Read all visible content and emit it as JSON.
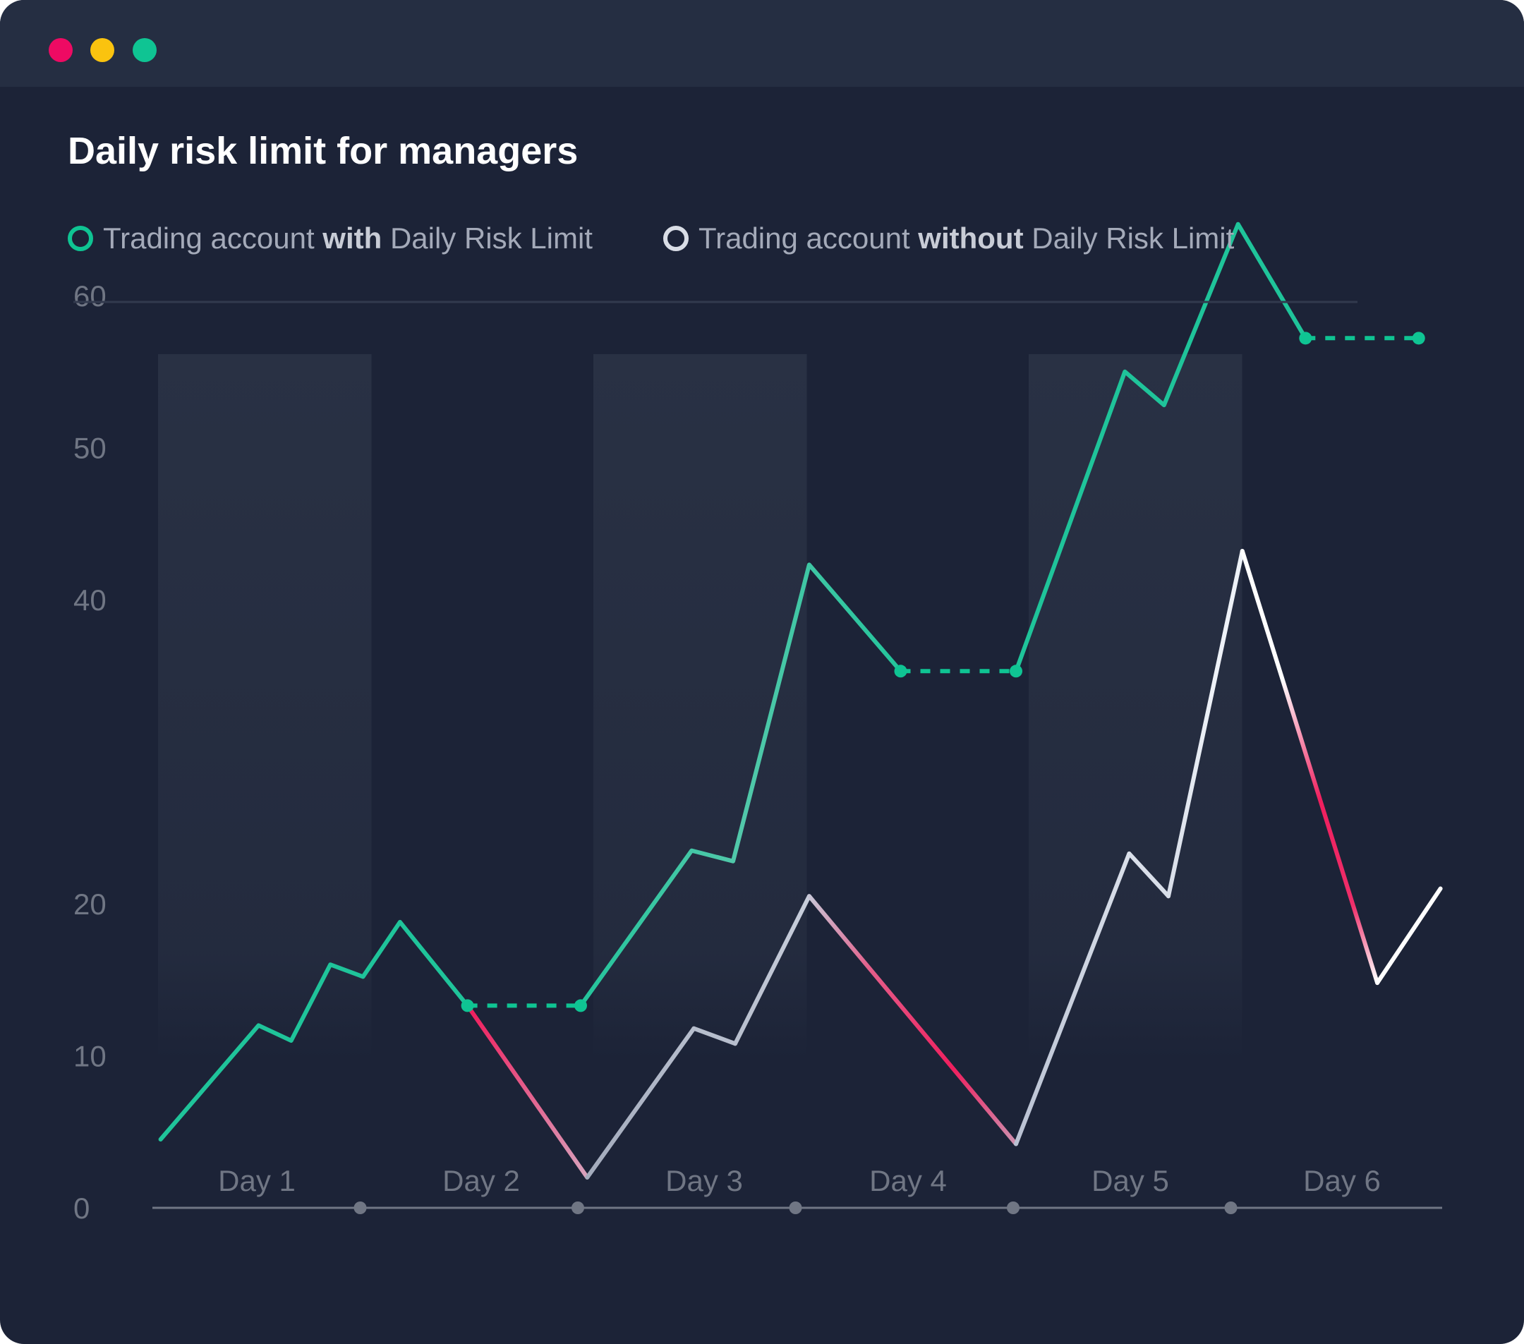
{
  "window": {
    "controls": [
      {
        "name": "close",
        "color": "#ee0a63"
      },
      {
        "name": "minimize",
        "color": "#fac30f"
      },
      {
        "name": "maximize",
        "color": "#0fc493"
      }
    ]
  },
  "colors": {
    "background": "#1c2337",
    "titlebar": "#252e42",
    "series_with": "#0fc493",
    "series_without": "#ffffff",
    "loss": "#ef1f5e",
    "axis": "#707684",
    "text_muted": "#707684",
    "band": "#293144"
  },
  "chart_data": {
    "type": "line",
    "title": "Daily risk limit for managers",
    "legend": {
      "placement": "top-left",
      "items": [
        {
          "prefix": "Trading account ",
          "emphasis": "with",
          "suffix": " Daily Risk Limit",
          "color": "#0fc493"
        },
        {
          "prefix": "Trading account ",
          "emphasis": "without",
          "suffix": " Daily Risk Limit",
          "color": "#d9dde6"
        }
      ]
    },
    "xlabel": "",
    "ylabel": "",
    "ylim": [
      0,
      65
    ],
    "yticks": [
      0,
      10,
      20,
      40,
      50,
      60
    ],
    "xlim": [
      0,
      6
    ],
    "categories": [
      "Day 1",
      "Day 2",
      "Day 3",
      "Day 4",
      "Day 5",
      "Day 6"
    ],
    "day_boundaries": [
      1,
      2,
      3,
      4,
      5
    ],
    "shaded_days": [
      1,
      3,
      5
    ],
    "grid": false,
    "series": [
      {
        "name": "Trading account with Daily Risk Limit",
        "color": "#0fc493",
        "points": [
          {
            "x": 0.07,
            "y": 4.5
          },
          {
            "x": 0.52,
            "y": 12.0
          },
          {
            "x": 0.67,
            "y": 11.0
          },
          {
            "x": 0.85,
            "y": 16.0
          },
          {
            "x": 1.0,
            "y": 15.2
          },
          {
            "x": 1.17,
            "y": 18.8
          },
          {
            "x": 1.48,
            "y": 13.3
          },
          {
            "x": 2.0,
            "y": 13.3,
            "limit": true
          },
          {
            "x": 2.51,
            "y": 23.5
          },
          {
            "x": 2.7,
            "y": 22.8
          },
          {
            "x": 3.05,
            "y": 42.3
          },
          {
            "x": 3.47,
            "y": 35.3
          },
          {
            "x": 4.0,
            "y": 35.3,
            "limit": true
          },
          {
            "x": 4.5,
            "y": 55.0
          },
          {
            "x": 4.68,
            "y": 52.8
          },
          {
            "x": 5.02,
            "y": 64.7
          },
          {
            "x": 5.33,
            "y": 57.2
          },
          {
            "x": 5.85,
            "y": 57.2,
            "limit": true
          }
        ]
      },
      {
        "name": "Trading account without Daily Risk Limit",
        "color": "#ffffff",
        "loss_color": "#ef1f5e",
        "points": [
          {
            "x": 1.48,
            "y": 13.3
          },
          {
            "x": 2.03,
            "y": 2.0
          },
          {
            "x": 2.52,
            "y": 11.8
          },
          {
            "x": 2.71,
            "y": 10.8
          },
          {
            "x": 3.05,
            "y": 20.5
          },
          {
            "x": 4.0,
            "y": 4.2
          },
          {
            "x": 4.52,
            "y": 23.3
          },
          {
            "x": 4.7,
            "y": 20.5
          },
          {
            "x": 5.04,
            "y": 43.2
          },
          {
            "x": 5.66,
            "y": 14.8
          },
          {
            "x": 5.95,
            "y": 21.0
          }
        ]
      }
    ]
  }
}
